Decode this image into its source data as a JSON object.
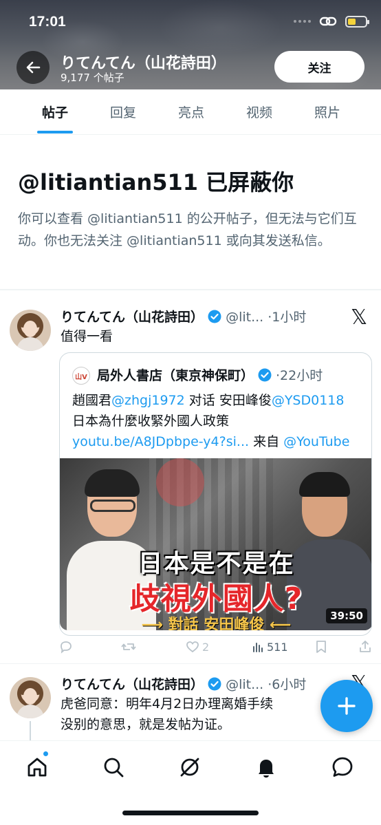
{
  "status_bar": {
    "time": "17:01"
  },
  "header": {
    "name": "りてんてん（山花詩田）",
    "post_count": "9,177 个帖子",
    "follow_label": "关注"
  },
  "tabs": [
    {
      "label": "帖子"
    },
    {
      "label": "回复"
    },
    {
      "label": "亮点"
    },
    {
      "label": "视频"
    },
    {
      "label": "照片"
    }
  ],
  "blocked": {
    "title": "@litiantian511 已屏蔽你",
    "description": "你可以查看 @litiantian511 的公开帖子，但无法与它们互动。你也无法关注 @litiantian511 或向其发送私信。"
  },
  "posts": [
    {
      "name": "りてんてん（山花詩田）",
      "handle_time": "@lit... ·1小时",
      "text": "值得一看",
      "quote": {
        "avatar_text": "山V",
        "name": "局外人書店（東京神保町）",
        "time": "·22小时",
        "text_parts": [
          "趙國君",
          "@zhgj1972",
          " 对话 安田峰俊",
          "@YSD0118",
          "日本為什麼收緊外國人政策 ",
          "youtu.be/A8JDpbpe-y4?si...",
          " 来自 ",
          "@YouTube"
        ],
        "video": {
          "line1": "日本是不是在",
          "line2": "歧視外國人?",
          "line3": "⟶ 對話 安田峰俊 ⟵",
          "duration": "39:50"
        }
      },
      "actions": {
        "likes": "2",
        "views": "511"
      }
    },
    {
      "name": "りてんてん（山花詩田）",
      "handle_time": "@lit... ·6小时",
      "text_line1": "虎爸同意：明年4月2日办理离婚手续",
      "text_line2": "没别的意思，就是发帖为证。"
    }
  ],
  "colors": {
    "accent": "#1d9bf0",
    "text": "#0f1419",
    "secondary": "#536471"
  }
}
